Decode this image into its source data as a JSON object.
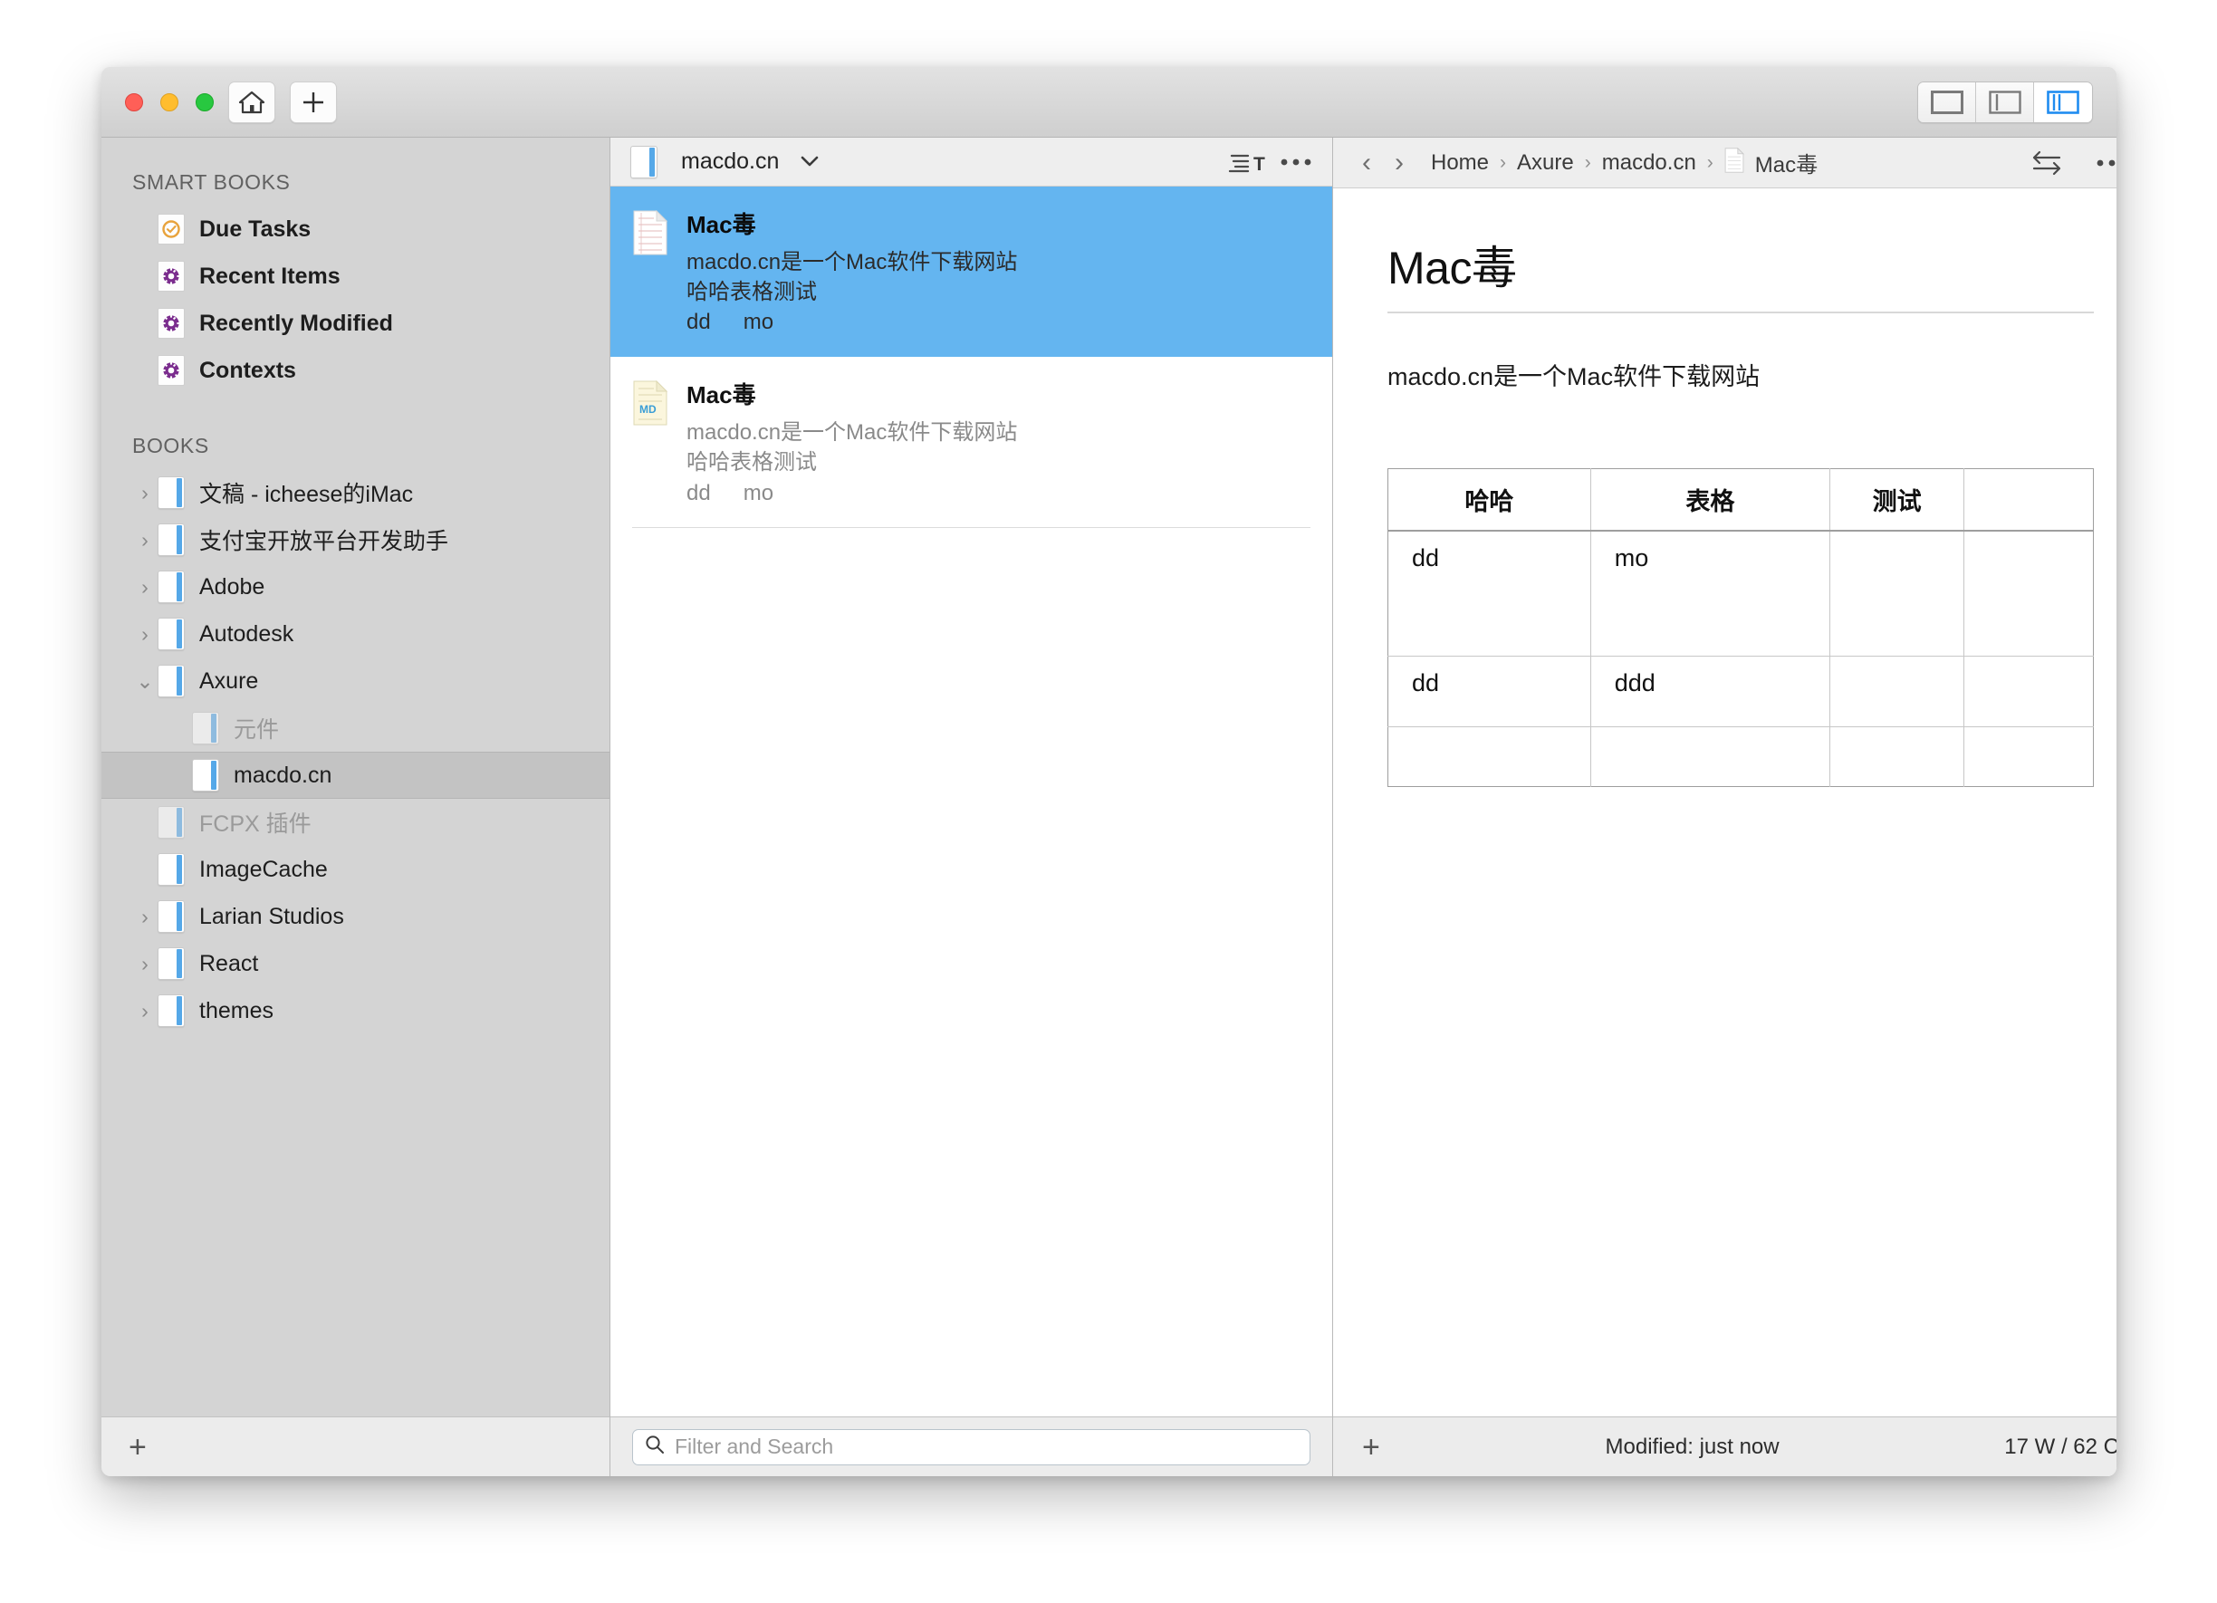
{
  "window": {
    "traffic_lights": [
      "close",
      "minimize",
      "zoom"
    ],
    "home_button_label": "Home",
    "new_button_label": "New",
    "view_modes": [
      {
        "name": "single-pane",
        "active": false
      },
      {
        "name": "two-pane",
        "active": false
      },
      {
        "name": "three-pane",
        "active": true
      }
    ]
  },
  "sidebar": {
    "smart_books_header": "SMART BOOKS",
    "smart_books": [
      {
        "label": "Due Tasks",
        "icon": "check-circle-icon"
      },
      {
        "label": "Recent Items",
        "icon": "gear-circle-icon"
      },
      {
        "label": "Recently Modified",
        "icon": "gear-circle-icon"
      },
      {
        "label": "Contexts",
        "icon": "gear-circle-icon"
      }
    ],
    "books_header": "BOOKS",
    "books": [
      {
        "label": "文稿 - icheese的iMac",
        "expandable": true,
        "expanded": false,
        "muted": false,
        "nested": false,
        "selected": false
      },
      {
        "label": "支付宝开放平台开发助手",
        "expandable": true,
        "expanded": false,
        "muted": false,
        "nested": false,
        "selected": false
      },
      {
        "label": "Adobe",
        "expandable": true,
        "expanded": false,
        "muted": false,
        "nested": false,
        "selected": false
      },
      {
        "label": "Autodesk",
        "expandable": true,
        "expanded": false,
        "muted": false,
        "nested": false,
        "selected": false
      },
      {
        "label": "Axure",
        "expandable": true,
        "expanded": true,
        "muted": false,
        "nested": false,
        "selected": false
      },
      {
        "label": "元件",
        "expandable": false,
        "expanded": false,
        "muted": true,
        "nested": true,
        "selected": false
      },
      {
        "label": "macdo.cn",
        "expandable": false,
        "expanded": false,
        "muted": false,
        "nested": true,
        "selected": true
      },
      {
        "label": "FCPX 插件",
        "expandable": false,
        "expanded": false,
        "muted": true,
        "nested": false,
        "selected": false
      },
      {
        "label": "ImageCache",
        "expandable": false,
        "expanded": false,
        "muted": false,
        "nested": false,
        "selected": false
      },
      {
        "label": "Larian Studios",
        "expandable": true,
        "expanded": false,
        "muted": false,
        "nested": false,
        "selected": false
      },
      {
        "label": "React",
        "expandable": true,
        "expanded": false,
        "muted": false,
        "nested": false,
        "selected": false
      },
      {
        "label": "themes",
        "expandable": true,
        "expanded": false,
        "muted": false,
        "nested": false,
        "selected": false
      }
    ],
    "add_button_label": "+"
  },
  "list_panel": {
    "header": {
      "book_title": "macdo.cn",
      "chevron": "⌄",
      "sort_icon": "sort-text-icon",
      "more_icon": "ellipsis-icon"
    },
    "items": [
      {
        "title": "Mac毒",
        "snippet_line1": "macdo.cn是一个Mac软件下载网站",
        "snippet_line2": "哈哈表格测试",
        "cell1": "dd",
        "cell2": "mo",
        "icon": "text-document-icon",
        "selected": true
      },
      {
        "title": "Mac毒",
        "snippet_line1": "macdo.cn是一个Mac软件下载网站",
        "snippet_line2": "哈哈表格测试",
        "cell1": "dd",
        "cell2": "mo",
        "icon": "markdown-document-icon",
        "badge": "MD",
        "selected": false
      }
    ],
    "search_placeholder": "Filter and Search",
    "search_value": ""
  },
  "detail_panel": {
    "back_icon": "chevron-left-icon",
    "forward_icon": "chevron-right-icon",
    "breadcrumb": [
      "Home",
      "Axure",
      "macdo.cn",
      "Mac毒"
    ],
    "breadcrumb_separator": "›",
    "swap_icon": "swap-arrows-icon",
    "more_icon": "ellipsis-icon",
    "doc_title": "Mac毒",
    "paragraph": "macdo.cn是一个Mac软件下载网站",
    "table": {
      "headers": [
        "哈哈",
        "表格",
        "测试",
        ""
      ],
      "rows": [
        [
          "dd",
          "mo",
          "",
          ""
        ],
        [
          "dd",
          "ddd",
          "",
          ""
        ],
        [
          "",
          "",
          "",
          ""
        ]
      ]
    },
    "add_button_label": "+",
    "status": "Modified: just now",
    "counts": "17 W / 62 C"
  },
  "colors": {
    "selection_blue": "#64b5f0",
    "sidebar_bg": "#d4d4d4",
    "book_spine": "#55a8e8",
    "accent_active": "#1f8cf0"
  }
}
